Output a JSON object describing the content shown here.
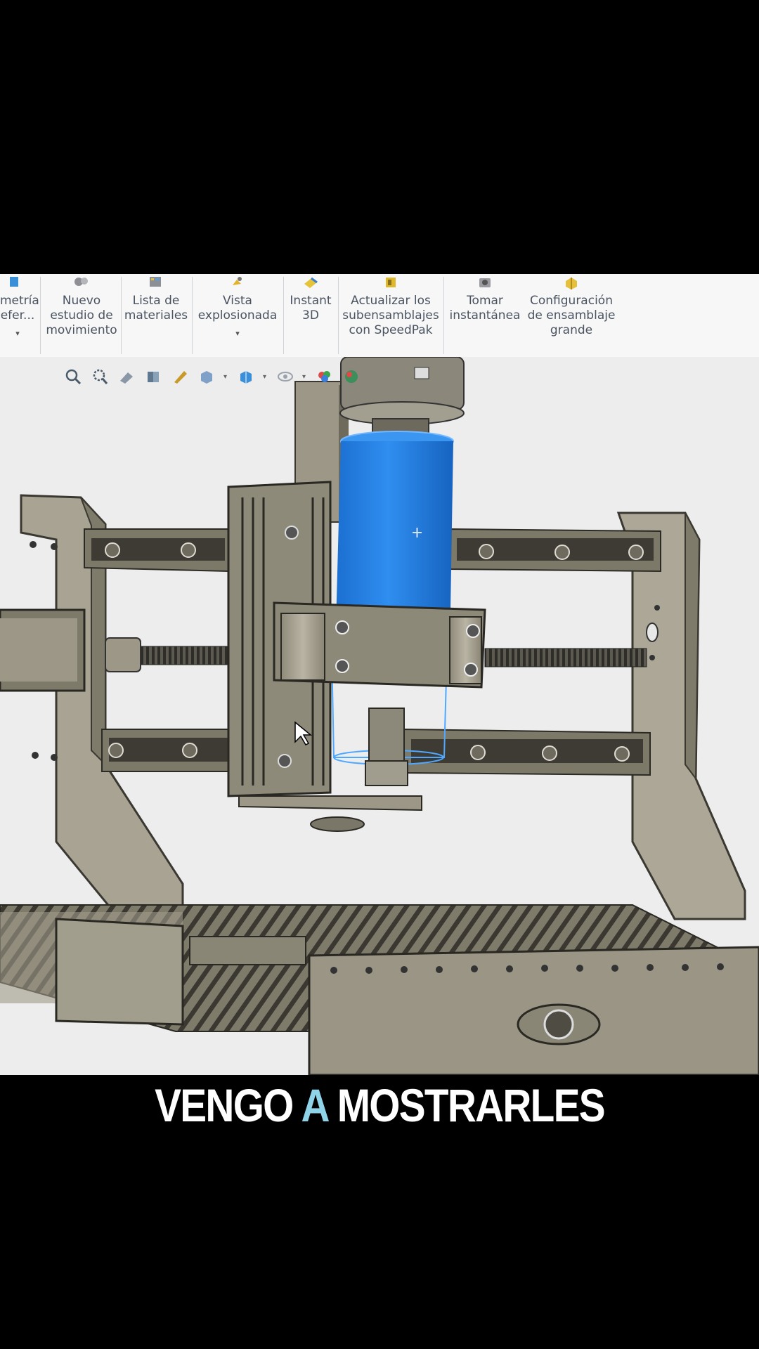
{
  "ribbon": {
    "items": [
      {
        "label": "metría\nefer...",
        "icon": "geometry-icon",
        "caret": "▾"
      },
      {
        "label": "Nuevo\nestudio de\nmovimiento",
        "icon": "motion-study-icon"
      },
      {
        "label": "Lista de\nmateriales",
        "icon": "bill-of-materials-icon"
      },
      {
        "label": "Vista\nexplosionada",
        "icon": "exploded-view-icon",
        "caret": "▾"
      },
      {
        "label": "Instant\n3D",
        "icon": "instant3d-icon"
      },
      {
        "label": "Actualizar los\nsubensamblajes\ncon SpeedPak",
        "icon": "speedpak-icon"
      },
      {
        "label": "Tomar\ninstantánea",
        "icon": "snapshot-icon"
      },
      {
        "label": "Configuración\nde ensamblaje\ngrande",
        "icon": "large-assembly-icon"
      }
    ]
  },
  "subtitle": {
    "word1": "VENGO",
    "word2": "A",
    "word3": "MOSTRARLES"
  },
  "colors": {
    "selection": "#1f7fe0",
    "metal": "#a29e8e",
    "highlight_word": "#8fd3e8"
  }
}
